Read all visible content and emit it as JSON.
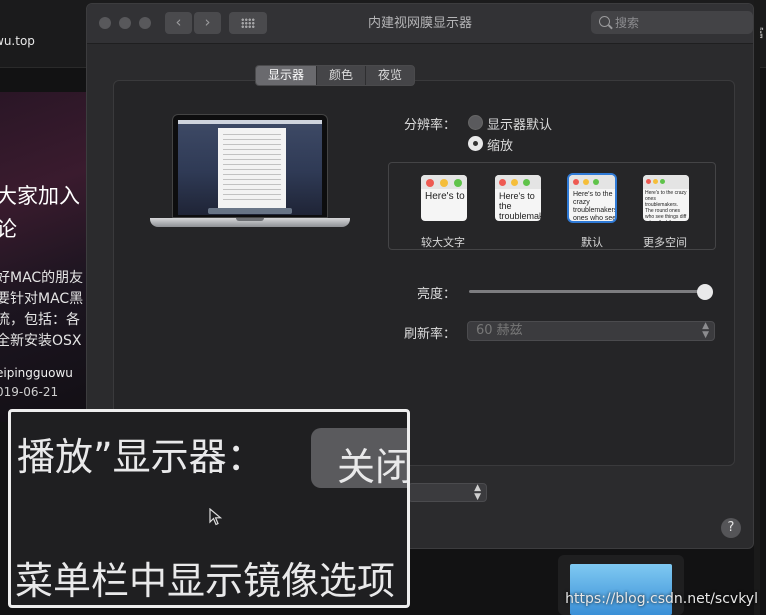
{
  "background_page": {
    "site_logo_fragment": "wu.top",
    "right_edge_char": "富",
    "hero_title_lines": [
      "大家加入",
      "论"
    ],
    "hero_desc_lines": [
      "好MAC的朋友",
      "要针对MAC黑",
      "流，包括：各",
      "全新安装OSX"
    ],
    "author": "eipingguowu",
    "date": "019-06-21",
    "watermark": "https://blog.csdn.net/scvkyl"
  },
  "window": {
    "title": "内建视网膜显示器",
    "nav_back": "‹",
    "nav_forward": "›",
    "search": {
      "placeholder": "搜索",
      "value": ""
    }
  },
  "tabs": [
    {
      "label": "显示器",
      "active": true
    },
    {
      "label": "颜色",
      "active": false
    },
    {
      "label": "夜览",
      "active": false
    }
  ],
  "resolution": {
    "label": "分辨率：",
    "options": [
      {
        "label": "显示器默认",
        "selected": false
      },
      {
        "label": "缩放",
        "selected": true
      }
    ],
    "scaled_options": [
      {
        "caption": "较大文字",
        "sample": "Here's to the troublemakers",
        "selected": false
      },
      {
        "caption": "",
        "sample": "Here's to the troublemakers. ones who see",
        "selected": false
      },
      {
        "caption": "默认",
        "sample": "Here's to the crazy troublemakers. ones who see th rules. And they",
        "selected": true
      },
      {
        "caption": "更多空间",
        "sample": "Here's to the crazy ones troublemakers. The round ones who see things diff rules. And they have no can quote them, disagree them. About the only th Because they change t",
        "selected": false
      }
    ]
  },
  "brightness": {
    "label": "亮度：",
    "value": 1.0
  },
  "refresh_rate": {
    "label": "刷新率：",
    "value": "60 赫兹"
  },
  "help_label": "?",
  "zoom_overlay": {
    "line1": "播放”显示器：",
    "button": "关闭",
    "line2": "菜单栏中显示镜像选项"
  }
}
